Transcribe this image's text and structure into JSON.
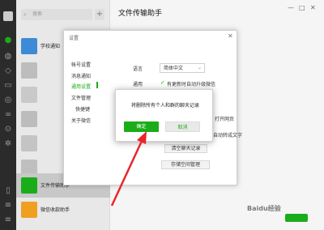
{
  "sidebar": {
    "search_placeholder": "搜索",
    "add_symbol": "+"
  },
  "chats": [
    {
      "name": "学校通知",
      "time": ""
    },
    {
      "name": "文件传输助手",
      "time": ""
    },
    {
      "name": "微信收款助手",
      "time": ""
    }
  ],
  "main": {
    "title": "文件传输助手",
    "controls": [
      "—",
      "□",
      "✕"
    ]
  },
  "settings": {
    "title": "设置",
    "close": "✕",
    "menu": [
      {
        "label": "帐号设置",
        "active": false
      },
      {
        "label": "消息通知",
        "active": false
      },
      {
        "label": "通用设置",
        "active": true
      },
      {
        "label": "文件管理",
        "active": false
      },
      {
        "label": "快捷键",
        "active": false
      },
      {
        "label": "关于微信",
        "active": false
      }
    ],
    "language_label": "语言",
    "language_value": "简体中文",
    "general_label": "通用",
    "auto_update": "有更新时自动升级微信",
    "open_web": "打开网页",
    "auto_convert": "自动转成文字",
    "clear_chat": "清空聊天记录",
    "storage": "存储空间管理"
  },
  "confirm": {
    "message": "将删除所有个人和群的聊天记录",
    "ok": "确定",
    "cancel": "取消"
  },
  "watermark": {
    "text": "Baidu经验",
    "sub": ""
  },
  "colors": {
    "accent": "#1aad19",
    "arrow": "#e8262a"
  }
}
